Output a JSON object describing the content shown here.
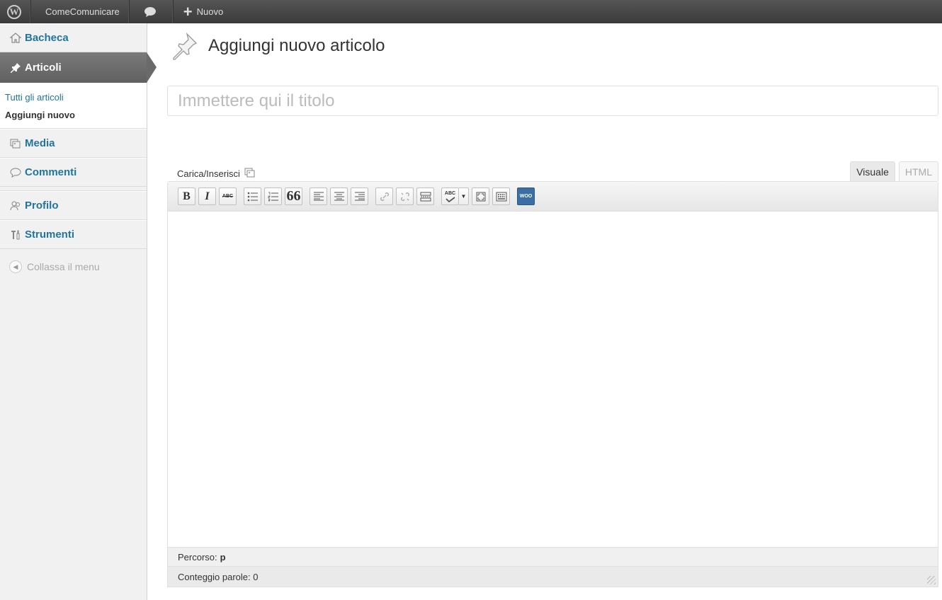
{
  "adminbar": {
    "site_name": "ComeComunicare",
    "new_label": "Nuovo",
    "icons": [
      "wordpress-logo-icon",
      "comment-bubble-icon",
      "plus-icon"
    ]
  },
  "sidebar": {
    "items": [
      {
        "label": "Bacheca",
        "icon": "house-icon"
      },
      {
        "label": "Articoli",
        "icon": "pushpin-icon"
      },
      {
        "label": "Media",
        "icon": "media-icon"
      },
      {
        "label": "Commenti",
        "icon": "comment-bubble-icon"
      },
      {
        "label": "Profilo",
        "icon": "users-icon"
      },
      {
        "label": "Strumenti",
        "icon": "tools-icon"
      }
    ],
    "submenu": {
      "all_posts": "Tutti gli articoli",
      "add_new": "Aggiungi nuovo"
    },
    "collapse_label": "Collassa il menu"
  },
  "main": {
    "page_title": "Aggiungi nuovo articolo",
    "title_placeholder": "Immettere qui il titolo",
    "upload_label": "Carica/Inserisci",
    "tabs": {
      "visual": "Visuale",
      "html": "HTML"
    },
    "toolbar": {
      "bold": "B",
      "italic": "I",
      "strike": "ABC",
      "quote": "66",
      "spell": "ABC",
      "woo": "WOO"
    },
    "path_label": "Percorso:",
    "path_value": "p",
    "word_count_label": "Conteggio parole: 0"
  },
  "colors": {
    "adminbar_bg": "#464646",
    "link_blue": "#21759b",
    "active_menu_bg": "#6d6d6d"
  }
}
